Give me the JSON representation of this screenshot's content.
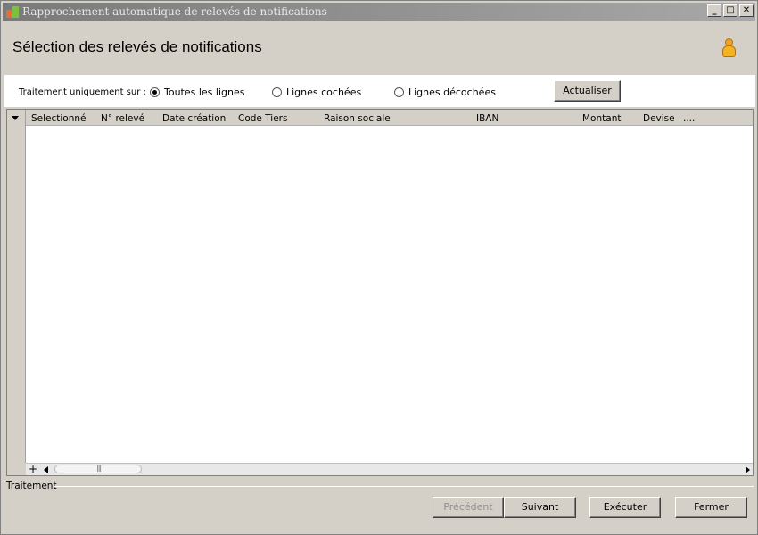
{
  "window": {
    "title": "Rapprochement automatique de relevés de notifications",
    "minimize_glyph": "_",
    "maximize_glyph": "□",
    "close_glyph": "✕"
  },
  "header": {
    "title": "Sélection des relevés de notifications",
    "icon": "user-icon"
  },
  "options": {
    "label": "Traitement uniquement sur :",
    "radios": [
      {
        "label": "Toutes les lignes",
        "selected": true
      },
      {
        "label": "Lignes cochées",
        "selected": false
      },
      {
        "label": "Lignes décochées",
        "selected": false
      }
    ],
    "refresh_label": "Actualiser"
  },
  "grid": {
    "columns": [
      "Selectionné",
      "N° relevé",
      "Date création",
      "Code Tiers",
      "Raison sociale",
      "IBAN",
      "Montant",
      "Devise",
      "...."
    ],
    "rows": [],
    "add_row_glyph": "+",
    "scroll_thumb_grip": "|||"
  },
  "footer": {
    "section_label": "Traitement",
    "buttons": {
      "previous": "Précédent",
      "next": "Suivant",
      "execute": "Exécuter",
      "close": "Fermer"
    }
  }
}
